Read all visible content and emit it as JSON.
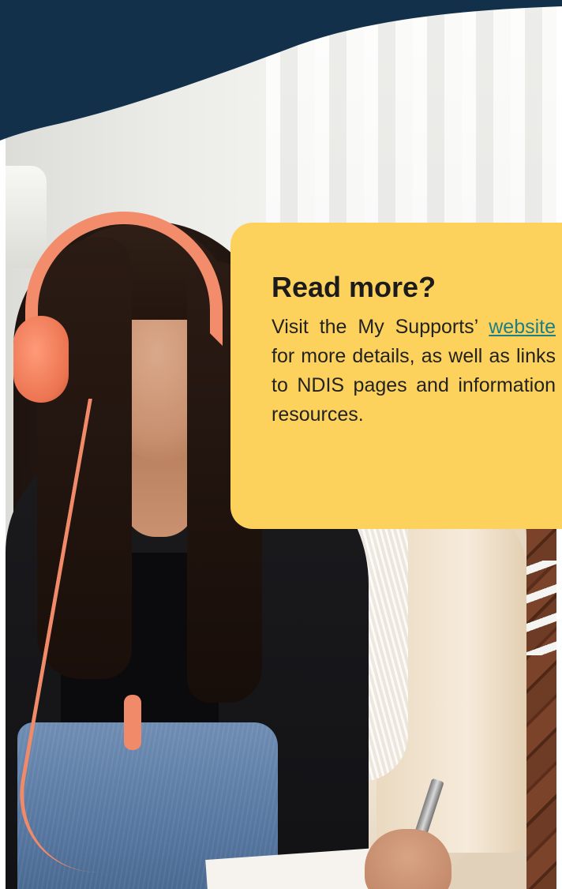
{
  "colors": {
    "header_navy": "#12304a",
    "card_yellow": "#fdd25c",
    "link_teal": "#1d7f86",
    "text_dark": "#1b1b1b"
  },
  "photo": {
    "description_icon": "girl-with-headphones-writing-photo"
  },
  "card": {
    "title": "Read more?",
    "body_before_link": "Visit  the My Supports’ ",
    "link_text": "website",
    "body_after_link": " for more details, as well as links to NDIS pages and information resources."
  }
}
